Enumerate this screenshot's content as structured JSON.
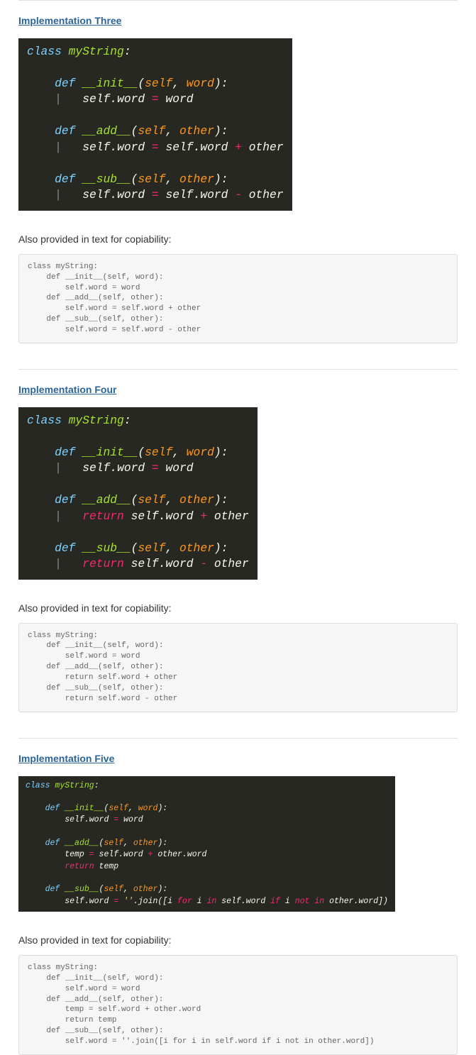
{
  "copy_label": "Also provided in text for copiability:",
  "sections": {
    "three": {
      "heading": "Implementation Three",
      "text": "class myString:\n    def __init__(self, word):\n        self.word = word\n    def __add__(self, other):\n        self.word = self.word + other\n    def __sub__(self, other):\n        self.word = self.word - other"
    },
    "four": {
      "heading": "Implementation Four",
      "text": "class myString:\n    def __init__(self, word):\n        self.word = word\n    def __add__(self, other):\n        return self.word + other\n    def __sub__(self, other):\n        return self.word - other"
    },
    "five": {
      "heading": "Implementation Five",
      "text": "class myString:\n    def __init__(self, word):\n        self.word = word\n    def __add__(self, other):\n        temp = self.word + other.word\n        return temp\n    def __sub__(self, other):\n        self.word = ''.join([i for i in self.word if i not in other.word])"
    }
  },
  "tokens": {
    "class": "class",
    "def": "def",
    "myString": "myString",
    "init": "__init__",
    "add": "__add__",
    "sub": "__sub__",
    "self": "self",
    "word_param": "word",
    "other": "other",
    "word_attr": "word",
    "return": "return",
    "temp": "temp",
    "join": "join",
    "for": "for",
    "i": "i",
    "in": "in",
    "if": "if",
    "not": "not",
    "emptystr": "''",
    "eq": " = ",
    "plus": " + ",
    "minus": " - ",
    "colon": ":",
    "lparen": "(",
    "rparen": ")",
    "comma": ", ",
    "dot": ".",
    "lbrack": "[",
    "rbrack": "]"
  }
}
